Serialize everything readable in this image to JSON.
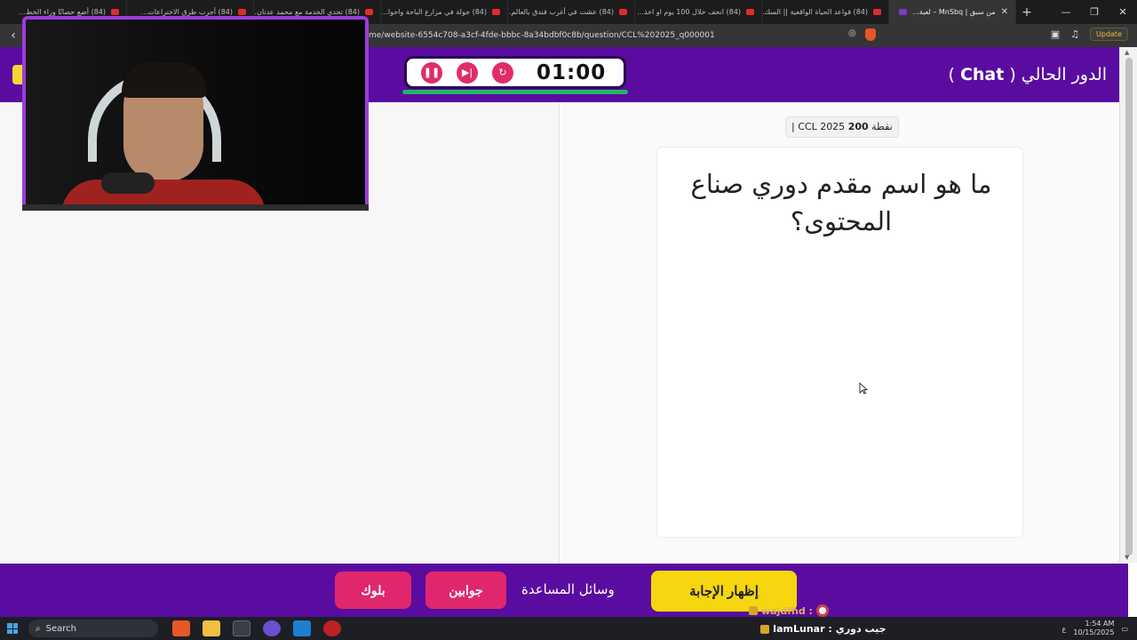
{
  "browser": {
    "tabs": [
      {
        "title": "(84) أضع حصانًا وراء الخط..."
      },
      {
        "title": "(84) أجرب طرق الاختراعات..."
      },
      {
        "title": "(84) تحدي الخدمة مع محمد عدنان..."
      },
      {
        "title": "(84) جولة في مزارع الباحة واجوا..."
      },
      {
        "title": "(84) عشت في أغرب فندق بالعالم..."
      },
      {
        "title": "(84) انحف خلال 100 يوم او اخذ..."
      },
      {
        "title": "(84) قواعد الحياة الواقعية || السك..."
      },
      {
        "title": "من سبق | MnSbq – لعبة..."
      }
    ],
    "new_tab": "+",
    "url": "me/website-6554c708-a3cf-4fde-bbbc-8a34bdbf0c8b/question/CCL%202025_q000001",
    "update_label": "Update"
  },
  "header": {
    "turn_prefix": "الدور الحالي (",
    "turn_name": "Chat",
    "turn_suffix": ")"
  },
  "timer": {
    "time": "01:00",
    "progress": 1.0
  },
  "question": {
    "points_label": "نقطة",
    "points_value": "200",
    "category": "CCL 2025 |",
    "text": "ما هو اسم مقدم دوري صناع المحتوى؟"
  },
  "footer": {
    "show_answer": "إظهار الإجابة",
    "help_label": "وسائل المساعدة",
    "answers_button": "جوابين",
    "block_button": "بلوك"
  },
  "taskbar": {
    "search_label": "Search",
    "time": "1:54 AM",
    "date": "10/15/2025",
    "lang": "ع"
  },
  "stream_chat": [
    {
      "user": "wajdfhd :",
      "message": ""
    },
    {
      "user": "IamLunar :",
      "message": "جيب دوري"
    }
  ],
  "colors": {
    "brand_purple": "#5a0ca0",
    "accent_yellow": "#f5d60f",
    "accent_pink": "#e0266c",
    "timer_green": "#23b36a"
  }
}
